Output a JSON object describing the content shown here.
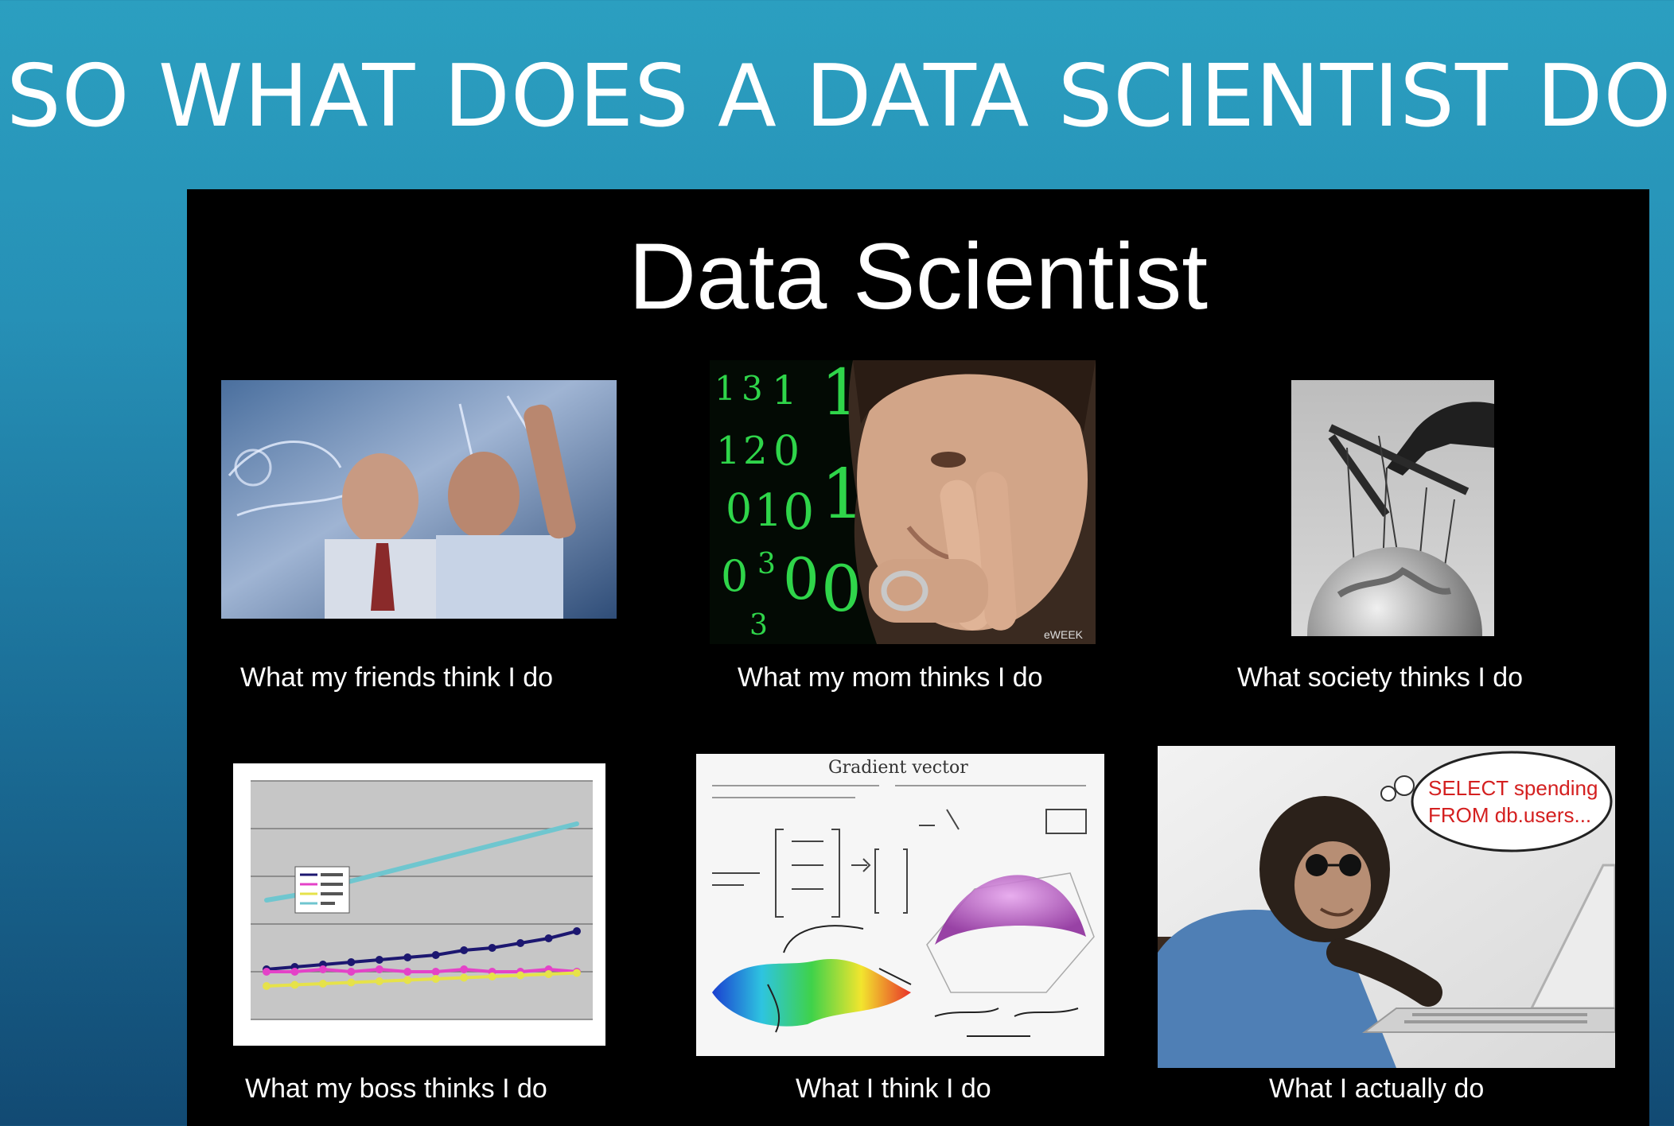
{
  "slide": {
    "title": "SO WHAT DOES A DATA SCIENTIST DO?"
  },
  "meme": {
    "title": "Data Scientist",
    "cells": [
      {
        "label": "What my friends think I do",
        "image": "scientists-pointing-at-glass-board"
      },
      {
        "label": "What my mom thinks I do",
        "image": "man-thinking-with-binary-digits"
      },
      {
        "label": "What society thinks I do",
        "image": "puppeteer-hand-controlling-globe"
      },
      {
        "label": "What my boss thinks I do",
        "image": "line-chart"
      },
      {
        "label": "What I think I do",
        "image": "gradient-vector-math-sketch"
      },
      {
        "label": "What I actually do",
        "image": "chimpanzee-typing-on-laptop"
      }
    ],
    "mom_image": {
      "digits": [
        "1",
        "3",
        "1",
        "1",
        "1",
        "2",
        "0",
        "0",
        "1",
        "0",
        "1",
        "0",
        "3",
        "0",
        "0",
        "3"
      ],
      "watermark": "eWEEK"
    },
    "think_image": {
      "heading": "Gradient vector"
    },
    "actual_image": {
      "speech_line1": "SELECT spending",
      "speech_line2": "FROM db.users..."
    },
    "boss_chart": {
      "type": "line",
      "series": [
        {
          "values": [
            5.0,
            5.2,
            5.5,
            5.8,
            6.1,
            6.4,
            6.7,
            7.0,
            7.3,
            7.6,
            7.9,
            8.2
          ],
          "color": "#6fc6cf"
        },
        {
          "values": [
            2.1,
            2.2,
            2.3,
            2.4,
            2.5,
            2.6,
            2.7,
            2.9,
            3.0,
            3.2,
            3.4,
            3.7
          ],
          "color": "#1c1770"
        },
        {
          "values": [
            2.0,
            2.0,
            2.1,
            2.0,
            2.1,
            2.0,
            2.0,
            2.1,
            2.0,
            2.0,
            2.1,
            2.0
          ],
          "color": "#e442c8"
        },
        {
          "values": [
            1.4,
            1.45,
            1.5,
            1.55,
            1.6,
            1.65,
            1.7,
            1.75,
            1.8,
            1.85,
            1.9,
            1.95
          ],
          "color": "#e6e24a"
        }
      ],
      "ylim": [
        0,
        10
      ]
    }
  }
}
